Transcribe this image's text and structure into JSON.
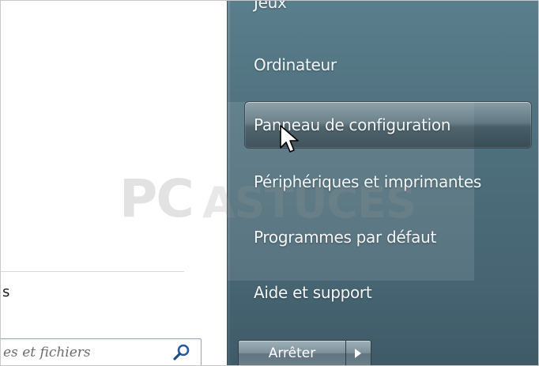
{
  "start_menu": {
    "right_items": [
      {
        "label": "Jeux",
        "id": "jeux"
      },
      {
        "label": "Ordinateur",
        "id": "ordinateur"
      },
      {
        "label": "Panneau de configuration",
        "id": "panneau-de-configuration"
      },
      {
        "label": "Périphériques et imprimantes",
        "id": "peripheriques-et-imprimantes"
      },
      {
        "label": "Programmes par défaut",
        "id": "programmes-par-defaut"
      },
      {
        "label": "Aide et support",
        "id": "aide-et-support"
      }
    ],
    "highlighted_item": "Panneau de configuration",
    "left_fragment": "s",
    "search_placeholder": "es et fichiers",
    "shutdown_label": "Arrêter"
  },
  "watermark": {
    "part1": "PC",
    "part2": "ASTUCES"
  },
  "icons": {
    "search": "search-icon",
    "shutdown_arrow": "arrow-right-icon",
    "cursor": "cursor-icon"
  },
  "colors": {
    "right_pane": "#4e6f7c",
    "menu_text": "#f4f7f8",
    "search_border": "#9aa7b6"
  }
}
